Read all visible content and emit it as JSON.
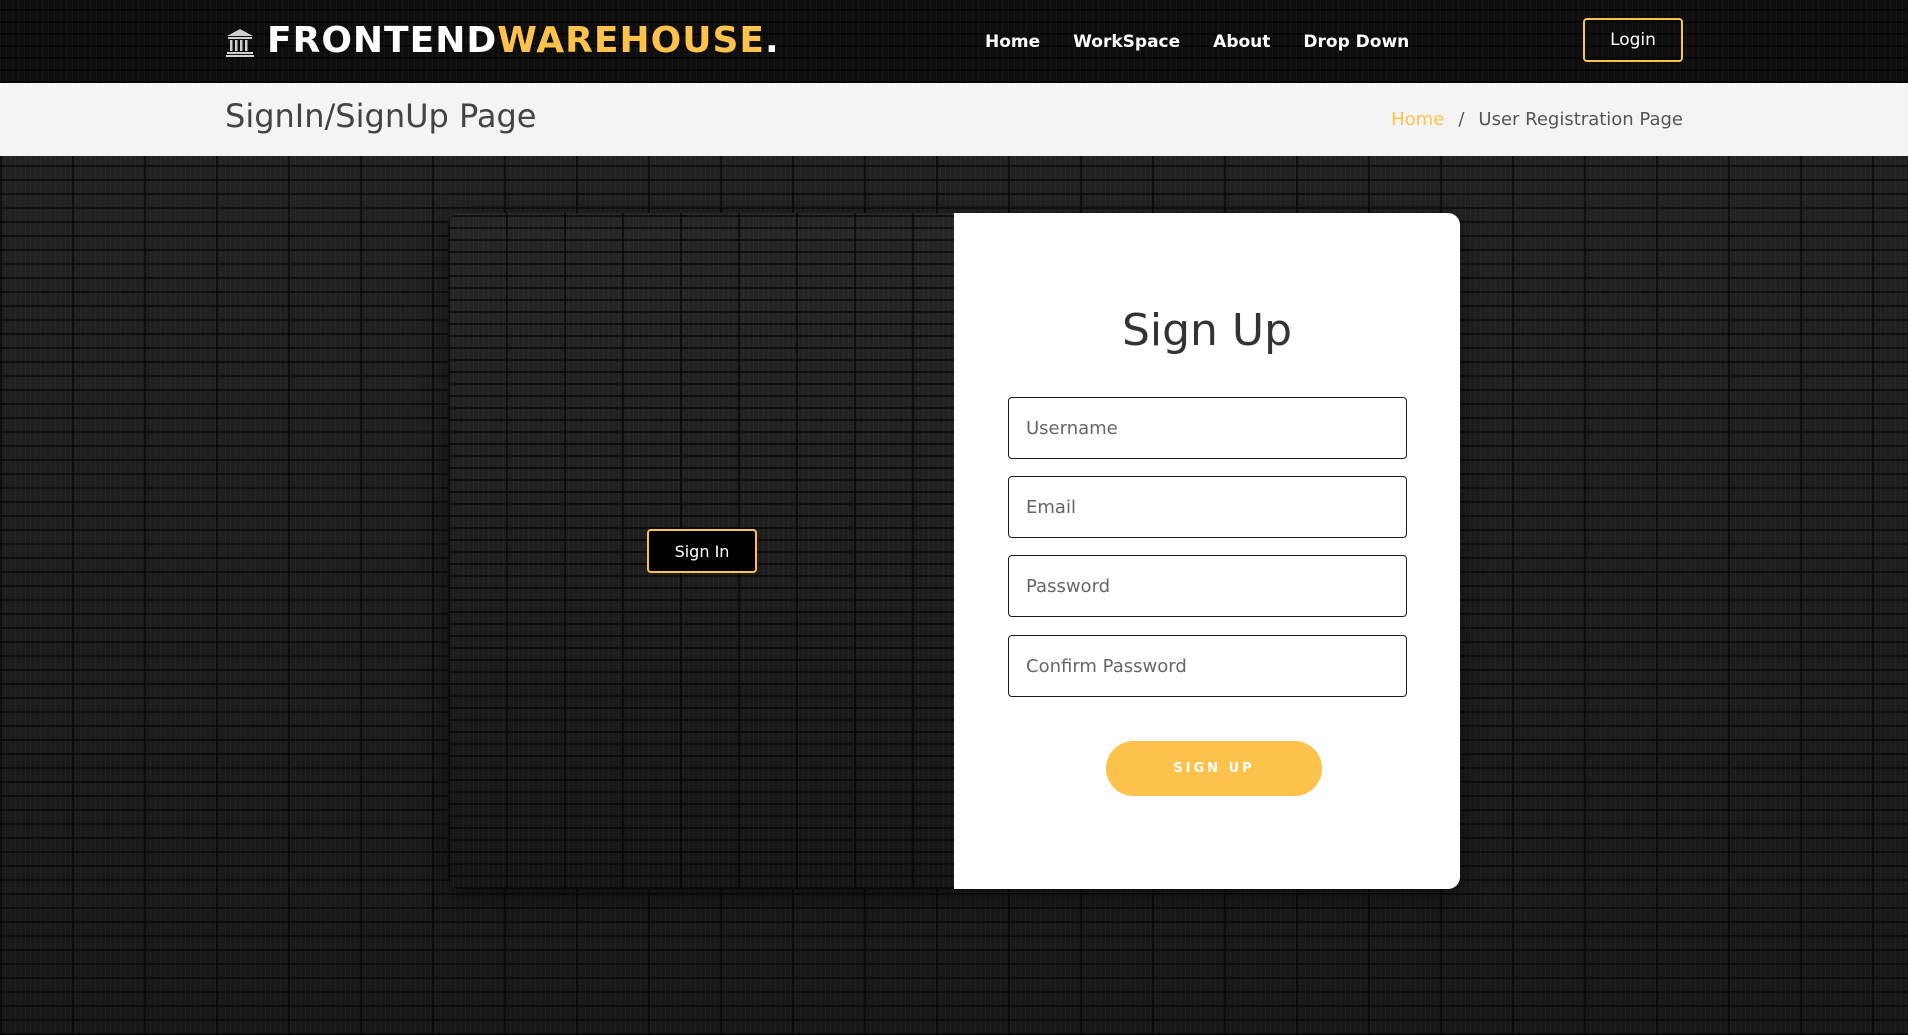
{
  "brand": {
    "part1": "FRONTEND",
    "part2": "WAREHOUSE",
    "dot": ".",
    "icon": "bank-building-icon"
  },
  "nav": {
    "items": [
      {
        "label": "Home"
      },
      {
        "label": "WorkSpace"
      },
      {
        "label": "About"
      },
      {
        "label": "Drop Down"
      }
    ],
    "login_label": "Login"
  },
  "header": {
    "page_title": "SignIn/SignUp Page",
    "breadcrumb": {
      "home": "Home",
      "separator": "/",
      "current": "User Registration Page"
    }
  },
  "auth": {
    "signin_label": "Sign In",
    "form_title": "Sign Up",
    "fields": {
      "username_placeholder": "Username",
      "email_placeholder": "Email",
      "password_placeholder": "Password",
      "confirm_placeholder": "Confirm Password"
    },
    "signup_label": "SIGN UP"
  },
  "colors": {
    "accent": "#fcc24c",
    "navbar_bg": "#0e0e0e",
    "breadcrumb_bg": "#f4f4f4",
    "form_bg": "#ffffff"
  }
}
